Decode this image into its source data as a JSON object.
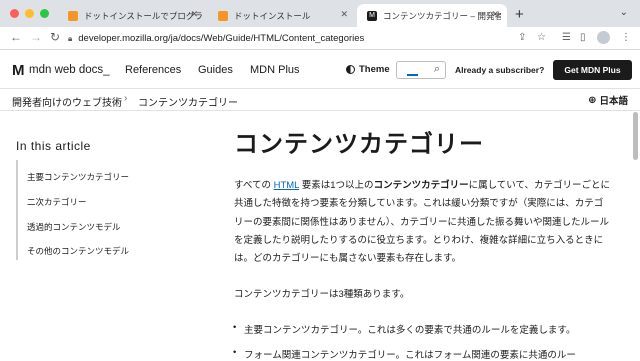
{
  "browser": {
    "tabs": [
      {
        "title": "ドットインストールでプログラミ",
        "favicon_color": "#f29727"
      },
      {
        "title": "ドットインストール",
        "favicon_color": "#f29727"
      },
      {
        "title": "コンテンツカテゴリー – 開発者ガ",
        "favicon_color": "#1b1b1b",
        "favicon_label": "M"
      }
    ],
    "url": "developer.mozilla.org/ja/docs/Web/Guide/HTML/Content_categories",
    "traffic_colors": [
      "#fe5f57",
      "#febc2e",
      "#28c840"
    ]
  },
  "header": {
    "logo_mark": "M",
    "logo_text": "mdn web docs_",
    "nav": [
      "References",
      "Guides",
      "MDN Plus"
    ],
    "theme_label": "Theme",
    "subscriber_text": "Already a subscriber?",
    "cta_label": "Get MDN Plus"
  },
  "breadcrumb": {
    "items": [
      "開発者向けのウェブ技術",
      "コンテンツカテゴリー"
    ],
    "separator": "›",
    "language": "日本語"
  },
  "toc": {
    "title": "In this article",
    "items": [
      "主要コンテンツカテゴリー",
      "二次カテゴリー",
      "透過的コンテンツモデル",
      "その他のコンテンツモデル"
    ]
  },
  "article": {
    "title": "コンテンツカテゴリー",
    "intro_prefix": "すべての ",
    "intro_link": "HTML",
    "intro_mid": " 要素は1つ以上の",
    "intro_bold": "コンテンツカテゴリー",
    "intro_rest": "に属していて、カテゴリーごとに共通した特徴を持つ要素を分類しています。これは緩い分類ですが（実際には、カテゴリーの要素間に関係性はありません）、カテゴリーに共通した振る舞いや関連したルールを定義したり説明したりするのに役立ちます。とりわけ、複雑な詳細に立ち入るときには。どのカテゴリーにも属さない要素も存在します。",
    "para2": "コンテンツカテゴリーは3種類あります。",
    "bullets": [
      "主要コンテンツカテゴリー。これは多くの要素で共通のルールを定義します。",
      "フォーム関連コンテンツカテゴリー。これはフォーム関連の要素に共通のルー"
    ]
  },
  "colors": {
    "link": "#0069c2",
    "text": "#1b1b1b",
    "cta_bg": "#1b1b1b"
  }
}
